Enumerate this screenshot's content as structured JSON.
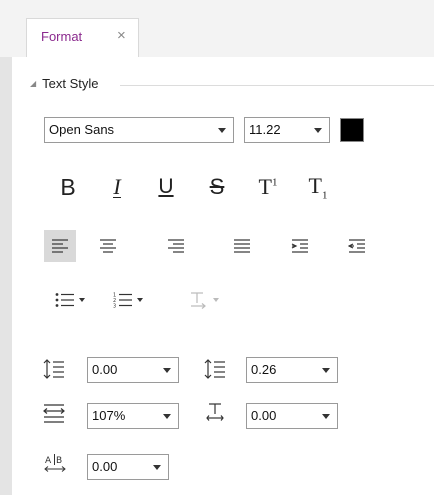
{
  "tab": {
    "label": "Format",
    "close_glyph": "×"
  },
  "section": {
    "title": "Text Style"
  },
  "font": {
    "family": "Open Sans",
    "size": "11.22",
    "color": "#000000"
  },
  "style_buttons": {
    "bold": "B",
    "italic": "I",
    "underline": "U",
    "strikethrough": "S",
    "superscript": "T",
    "subscript": "T",
    "sup_mark": "1",
    "sub_mark": "1"
  },
  "alignment": {
    "active": "align-left"
  },
  "spacing": {
    "line_spacing_before": "0.00",
    "line_spacing_after": "0.26",
    "character_scale": "107%",
    "baseline_offset": "0.00",
    "character_spacing": "0.00"
  },
  "colors": {
    "accent": "#8b2a8e"
  }
}
